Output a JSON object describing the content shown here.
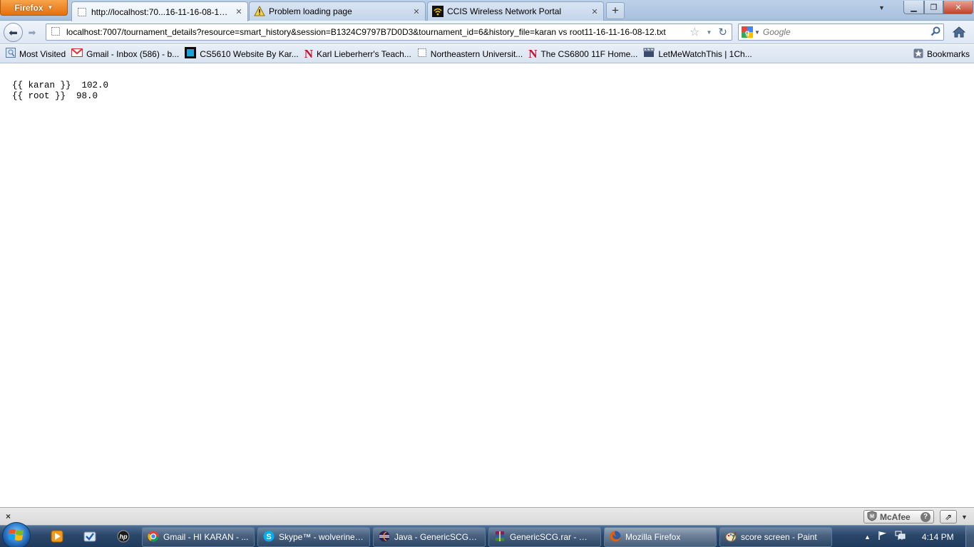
{
  "browser": {
    "menu_button_label": "Firefox",
    "tabs": [
      {
        "label": "http://localhost:70...16-11-16-08-12.txt",
        "icon": "blank-page-icon",
        "active": true
      },
      {
        "label": "Problem loading page",
        "icon": "warning-icon",
        "active": false
      },
      {
        "label": "CCIS Wireless Network Portal",
        "icon": "wireless-icon",
        "active": false
      }
    ],
    "new_tab_label": "+",
    "url": "localhost:7007/tournament_details?resource=smart_history&session=B1324C9797B7D0D3&tournament_id=6&history_file=karan vs root11-16-11-16-08-12.txt",
    "search_placeholder": "Google",
    "bookmarks": [
      {
        "label": "Most Visited",
        "icon": "most-visited-icon"
      },
      {
        "label": "Gmail - Inbox (586) - b...",
        "icon": "gmail-icon"
      },
      {
        "label": "CS5610 Website By Kar...",
        "icon": "cs5610-site-icon"
      },
      {
        "label": "Karl Lieberherr's Teach...",
        "icon": "northeastern-n-icon"
      },
      {
        "label": "Northeastern Universit...",
        "icon": "blank-page-icon"
      },
      {
        "label": "The CS6800 11F Home...",
        "icon": "northeastern-n-icon"
      },
      {
        "label": "LetMeWatchThis | 1Ch...",
        "icon": "film-clapper-icon"
      }
    ],
    "bookmarks_menu_label": "Bookmarks"
  },
  "page": {
    "line1": "{{ karan }}  102.0",
    "line2": "{{ root }}  98.0"
  },
  "addon_bar": {
    "mcafee_label": "McAfee",
    "close_label": "×"
  },
  "taskbar": {
    "items": [
      {
        "label": "Gmail - HI KARAN - ...",
        "icon": "chrome-icon",
        "active": false
      },
      {
        "label": "Skype™ - wolverine5...",
        "icon": "skype-icon",
        "active": false
      },
      {
        "label": "Java - GenericSCG_1...",
        "icon": "eclipse-icon",
        "active": false
      },
      {
        "label": "GenericSCG.rar - Win...",
        "icon": "winrar-icon",
        "active": false
      },
      {
        "label": "Mozilla Firefox",
        "icon": "firefox-icon",
        "active": true
      },
      {
        "label": "score screen - Paint",
        "icon": "paint-icon",
        "active": false
      }
    ],
    "clock": "4:14 PM"
  },
  "colors": {
    "firefox_orange": "#e5700e",
    "taskbar_blue": "#1f3a5c",
    "close_red": "#c4412a"
  }
}
